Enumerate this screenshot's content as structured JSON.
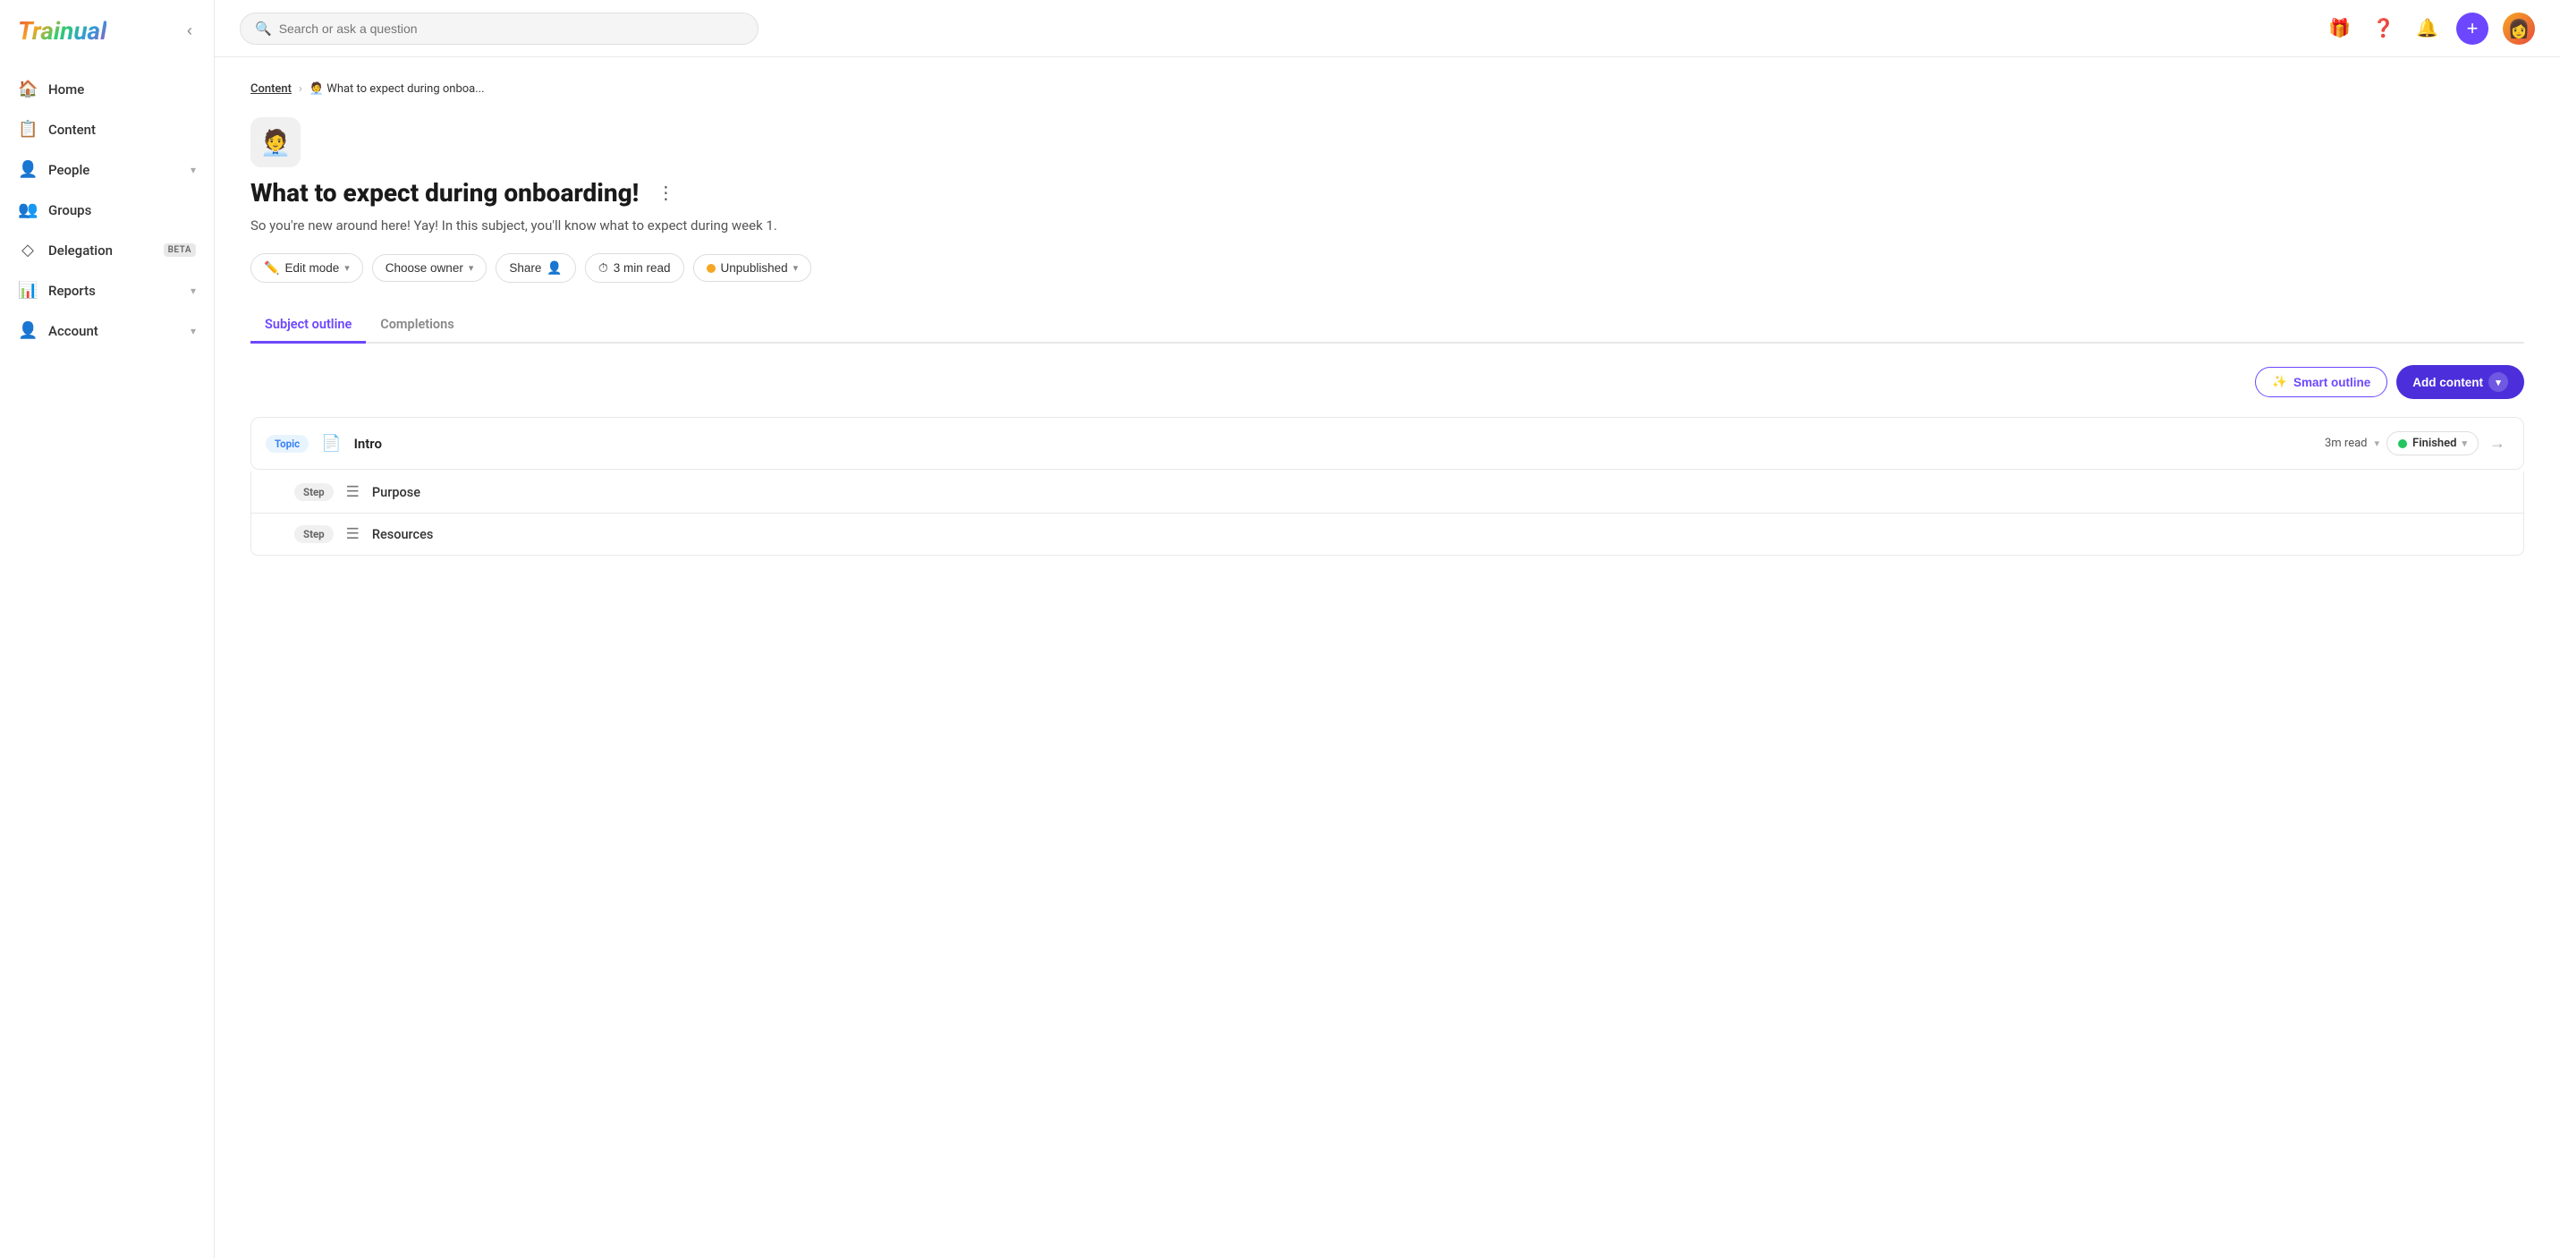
{
  "app": {
    "name": "Trainual"
  },
  "sidebar": {
    "collapse_label": "Collapse",
    "nav_items": [
      {
        "id": "home",
        "label": "Home",
        "icon": "🏠",
        "has_chevron": false
      },
      {
        "id": "content",
        "label": "Content",
        "icon": "📋",
        "has_chevron": false
      },
      {
        "id": "people",
        "label": "People",
        "icon": "👤",
        "has_chevron": true
      },
      {
        "id": "groups",
        "label": "Groups",
        "icon": "👥",
        "has_chevron": false
      },
      {
        "id": "delegation",
        "label": "Delegation",
        "icon": "◇",
        "has_chevron": false,
        "badge": "BETA"
      },
      {
        "id": "reports",
        "label": "Reports",
        "icon": "📊",
        "has_chevron": true
      },
      {
        "id": "account",
        "label": "Account",
        "icon": "👤",
        "has_chevron": true
      }
    ]
  },
  "topbar": {
    "search_placeholder": "Search or ask a question",
    "icons": [
      "gift",
      "help",
      "bell"
    ],
    "plus_label": "+"
  },
  "breadcrumb": {
    "parent": "Content",
    "separator": "›",
    "current": "🧑‍💼 What to expect during onboa..."
  },
  "subject": {
    "emoji": "🧑‍💼",
    "title": "What to expect during onboarding!",
    "description": "So you're new around here! Yay! In this subject, you'll know what to expect during week 1.",
    "actions": [
      {
        "id": "edit-mode",
        "label": "Edit mode",
        "icon": "✏️",
        "has_chevron": true
      },
      {
        "id": "choose-owner",
        "label": "Choose owner",
        "icon": "",
        "has_chevron": true
      },
      {
        "id": "share",
        "label": "Share",
        "icon": "👤",
        "has_chevron": false
      },
      {
        "id": "read-time",
        "label": "3 min read",
        "icon": "⏱",
        "has_chevron": false
      },
      {
        "id": "unpublished",
        "label": "Unpublished",
        "icon": "dot",
        "has_chevron": true
      }
    ]
  },
  "tabs": [
    {
      "id": "subject-outline",
      "label": "Subject outline",
      "active": true
    },
    {
      "id": "completions",
      "label": "Completions",
      "active": false
    }
  ],
  "outline": {
    "smart_outline_label": "Smart outline",
    "add_content_label": "Add content",
    "topics": [
      {
        "id": "intro",
        "type_label": "Topic",
        "icon": "📄",
        "name": "Intro",
        "read_time": "3m read",
        "status": "Finished",
        "steps": [
          {
            "id": "purpose",
            "type_label": "Step",
            "icon": "☰",
            "name": "Purpose"
          },
          {
            "id": "resources",
            "type_label": "Step",
            "icon": "☰",
            "name": "Resources"
          }
        ]
      }
    ]
  },
  "colors": {
    "accent": "#6c47ff",
    "accent_dark": "#4c2fdb",
    "status_unpublished": "#f5a623",
    "status_finished": "#22c55e",
    "topic_badge_bg": "#e8f4fd",
    "topic_badge_color": "#3b82f6"
  }
}
